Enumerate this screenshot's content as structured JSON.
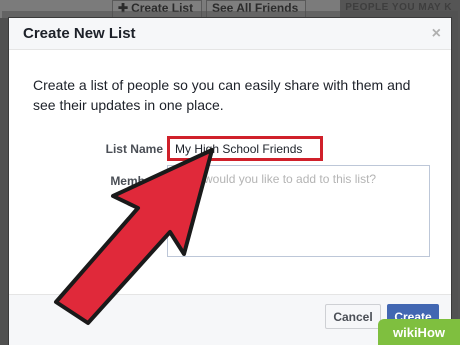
{
  "background": {
    "create_list_link": "Create List",
    "see_all_friends_link": "See All Friends",
    "side_header": "PEOPLE YOU MAY K"
  },
  "dialog": {
    "title": "Create New List",
    "close_symbol": "×",
    "description": "Create a list of people so you can easily share with them and see their updates in one place.",
    "list_name_label": "List Name",
    "list_name_value": "My High School Friends",
    "members_label": "Members",
    "members_placeholder": "Who would you like to add to this list?",
    "cancel_label": "Cancel",
    "create_label": "Create"
  },
  "watermark": {
    "brand": "wikiHow"
  },
  "colors": {
    "accent_blue": "#4267b2",
    "highlight_red": "#d0202a",
    "arrow_red": "#e0293a"
  }
}
